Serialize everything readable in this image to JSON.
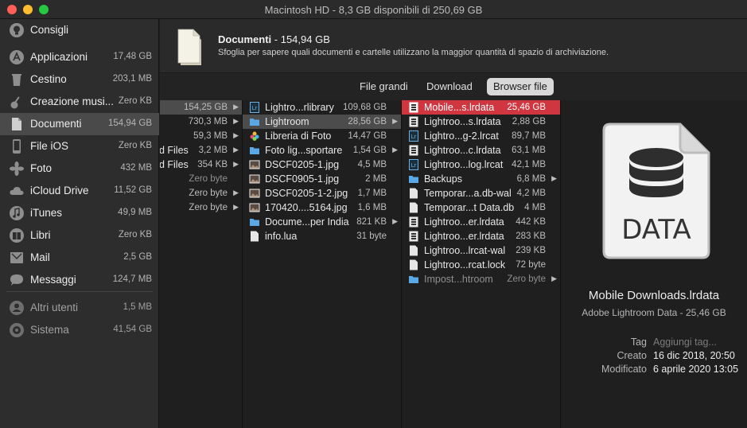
{
  "window": {
    "title": "Macintosh HD - 8,3 GB disponibili di 250,69 GB"
  },
  "sidebar": {
    "items": [
      {
        "label": "Consigli",
        "size": "",
        "icon": "lightbulb-icon"
      },
      {
        "label": "Applicazioni",
        "size": "17,48 GB",
        "icon": "applications-icon"
      },
      {
        "label": "Cestino",
        "size": "203,1 MB",
        "icon": "trash-icon"
      },
      {
        "label": "Creazione musi...",
        "size": "Zero KB",
        "icon": "guitar-icon"
      },
      {
        "label": "Documenti",
        "size": "154,94 GB",
        "icon": "document-icon",
        "selected": true
      },
      {
        "label": "File iOS",
        "size": "Zero KB",
        "icon": "phone-icon"
      },
      {
        "label": "Foto",
        "size": "432 MB",
        "icon": "photos-icon"
      },
      {
        "label": "iCloud Drive",
        "size": "11,52 GB",
        "icon": "cloud-icon"
      },
      {
        "label": "iTunes",
        "size": "49,9 MB",
        "icon": "music-note-icon"
      },
      {
        "label": "Libri",
        "size": "Zero KB",
        "icon": "book-icon"
      },
      {
        "label": "Mail",
        "size": "2,5 GB",
        "icon": "mail-icon"
      },
      {
        "label": "Messaggi",
        "size": "124,7 MB",
        "icon": "messages-icon"
      },
      {
        "label": "Altri utenti",
        "size": "1,5 MB",
        "icon": "users-icon"
      },
      {
        "label": "Sistema",
        "size": "41,54 GB",
        "icon": "system-icon"
      }
    ]
  },
  "header": {
    "title": "Documenti",
    "size": " - 154,94 GB",
    "description": "Sfoglia per sapere quali documenti e cartelle utilizzano la maggior quantità di spazio di archiviazione."
  },
  "tabs": [
    {
      "label": "File grandi",
      "active": false
    },
    {
      "label": "Download",
      "active": false
    },
    {
      "label": "Browser file",
      "active": true
    }
  ],
  "columns": [
    {
      "rows": [
        {
          "name": "",
          "size": "154,25 GB",
          "folder": true,
          "selected": true
        },
        {
          "name": "",
          "size": "730,3 MB",
          "folder": true
        },
        {
          "name": "",
          "size": "59,3 MB",
          "folder": true
        },
        {
          "name": "ud Files",
          "size": "3,2 MB",
          "folder": true
        },
        {
          "name": "ud Files",
          "size": "354 KB",
          "folder": true
        },
        {
          "name": "",
          "size": "Zero byte",
          "folder": false,
          "muted": true
        },
        {
          "name": "",
          "size": "Zero byte",
          "folder": true
        },
        {
          "name": "",
          "size": "Zero byte",
          "folder": true
        }
      ]
    },
    {
      "rows": [
        {
          "name": "Lightro...rlibrary",
          "size": "109,68 GB",
          "icon": "lrcat",
          "folder": false
        },
        {
          "name": "Lightroom",
          "size": "28,56 GB",
          "icon": "folder",
          "folder": true,
          "selected": true
        },
        {
          "name": "Libreria di Foto",
          "size": "14,47 GB",
          "icon": "photos",
          "folder": false
        },
        {
          "name": "Foto lig...sportare",
          "size": "1,54 GB",
          "icon": "folder",
          "folder": true
        },
        {
          "name": "DSCF0205-1.jpg",
          "size": "4,5 MB",
          "icon": "image",
          "folder": false
        },
        {
          "name": "DSCF0905-1.jpg",
          "size": "2 MB",
          "icon": "image",
          "folder": false
        },
        {
          "name": "DSCF0205-1-2.jpg",
          "size": "1,7 MB",
          "icon": "image",
          "folder": false
        },
        {
          "name": "170420....5164.jpg",
          "size": "1,6 MB",
          "icon": "image",
          "folder": false
        },
        {
          "name": "Docume...per India",
          "size": "821 KB",
          "icon": "folder",
          "folder": true
        },
        {
          "name": "info.lua",
          "size": "31 byte",
          "icon": "file",
          "folder": false
        }
      ]
    },
    {
      "rows": [
        {
          "name": "Mobile...s.lrdata",
          "size": "25,46 GB",
          "icon": "lrdata",
          "folder": false,
          "selected": true
        },
        {
          "name": "Lightroo...s.lrdata",
          "size": "2,88 GB",
          "icon": "lrdata",
          "folder": false
        },
        {
          "name": "Lightro...g-2.lrcat",
          "size": "89,7 MB",
          "icon": "lrcat",
          "folder": false
        },
        {
          "name": "Lightroo...c.lrdata",
          "size": "63,1 MB",
          "icon": "lrdata",
          "folder": false
        },
        {
          "name": "Lightroo...log.lrcat",
          "size": "42,1 MB",
          "icon": "lrcat",
          "folder": false
        },
        {
          "name": "Backups",
          "size": "6,8 MB",
          "icon": "folder",
          "folder": true
        },
        {
          "name": "Temporar...a.db-wal",
          "size": "4,2 MB",
          "icon": "file",
          "folder": false
        },
        {
          "name": "Temporar...t Data.db",
          "size": "4 MB",
          "icon": "file",
          "folder": false
        },
        {
          "name": "Lightroo...er.lrdata",
          "size": "442 KB",
          "icon": "lrdata",
          "folder": false
        },
        {
          "name": "Lightroo...er.lrdata",
          "size": "283 KB",
          "icon": "lrdata",
          "folder": false
        },
        {
          "name": "Lightroo...lrcat-wal",
          "size": "239 KB",
          "icon": "file",
          "folder": false
        },
        {
          "name": "Lightroo...rcat.lock",
          "size": "72 byte",
          "icon": "file",
          "folder": false
        },
        {
          "name": "Impost...htroom",
          "size": "Zero byte",
          "icon": "folder",
          "folder": true,
          "muted": true
        }
      ]
    }
  ],
  "preview": {
    "icon_text": "DATA",
    "name": "Mobile Downloads.lrdata",
    "kind": "Adobe Lightroom Data - 25,46 GB",
    "info": [
      {
        "key": "Tag",
        "value": "Aggiungi tag...",
        "placeholder": true
      },
      {
        "key": "Creato",
        "value": "16 dic 2018, 20:50"
      },
      {
        "key": "Modificato",
        "value": "6 aprile 2020 13:05"
      }
    ]
  },
  "colors": {
    "selection_red": "#d0363f",
    "selection_gray": "#4c4c4c",
    "folder_blue": "#5aa9e6"
  }
}
